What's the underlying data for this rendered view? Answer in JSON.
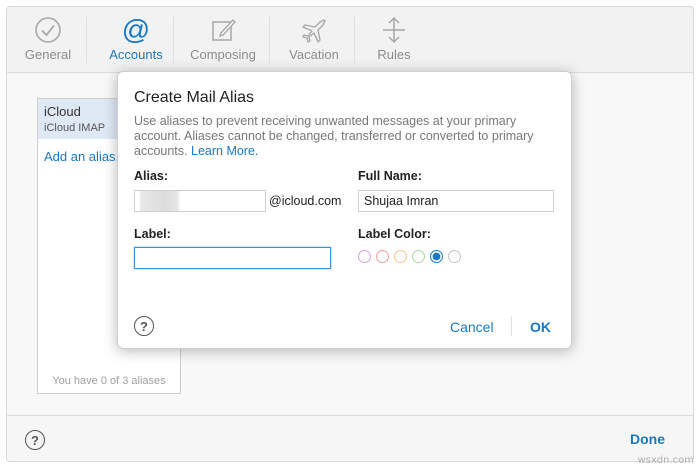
{
  "toolbar": {
    "items": [
      {
        "label": "General",
        "icon": "checkmark-circle-icon",
        "active": false
      },
      {
        "label": "Accounts",
        "icon": "at-sign-icon",
        "active": true
      },
      {
        "label": "Composing",
        "icon": "compose-icon",
        "active": false
      },
      {
        "label": "Vacation",
        "icon": "airplane-icon",
        "active": false
      },
      {
        "label": "Rules",
        "icon": "rules-arrows-icon",
        "active": false
      }
    ]
  },
  "alias_list": {
    "selected_title": "iCloud",
    "selected_subtitle": "iCloud IMAP",
    "add_link": "Add an alias...",
    "count_text": "You have 0 of 3 aliases"
  },
  "footer": {
    "help": "?",
    "done_label": "Done"
  },
  "dialog": {
    "title": "Create Mail Alias",
    "description": "Use aliases to prevent receiving unwanted messages at your primary account. Aliases cannot be changed, transferred or converted to primary accounts.",
    "learn_more": "Learn More.",
    "alias_label": "Alias:",
    "alias_value": "",
    "alias_suffix": "@icloud.com",
    "full_name_label": "Full Name:",
    "full_name_value": "Shujaa Imran",
    "label_label": "Label:",
    "label_value": "",
    "label_color_label": "Label Color:",
    "label_colors": [
      {
        "name": "purple",
        "color": "#d9a3df",
        "selected": false
      },
      {
        "name": "red",
        "color": "#f0a0a0",
        "selected": false
      },
      {
        "name": "orange",
        "color": "#f3c48a",
        "selected": false
      },
      {
        "name": "green",
        "color": "#a6d99b",
        "selected": false
      },
      {
        "name": "blue",
        "color": "#1a78c2",
        "selected": true
      },
      {
        "name": "gray",
        "color": "#c4c4c4",
        "selected": false
      }
    ],
    "help": "?",
    "cancel_label": "Cancel",
    "ok_label": "OK"
  },
  "watermark": "wsxdn.com",
  "colors": {
    "accent": "#1a78c2",
    "toolbar_inactive": "#8c8c8c"
  }
}
